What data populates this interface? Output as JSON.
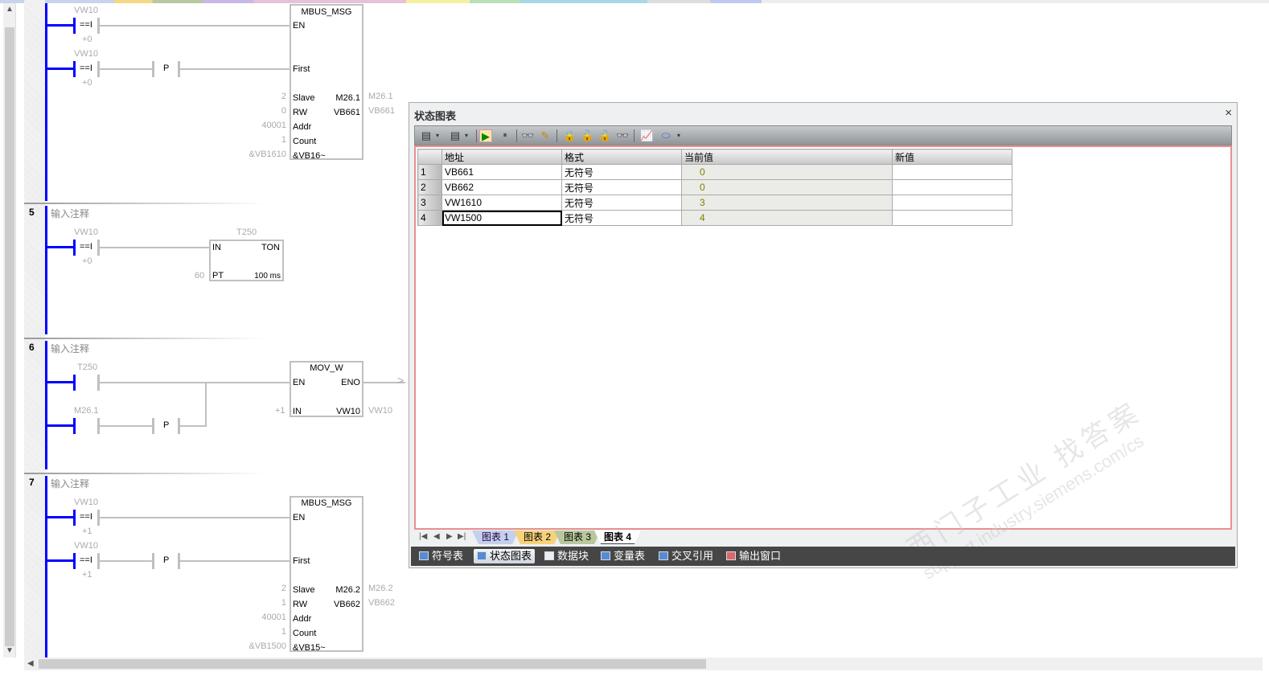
{
  "networks": [
    {
      "number": "",
      "rungs": [
        {
          "top": "VW10",
          "op": "==I",
          "bottom": "+0"
        },
        {
          "top": "VW10",
          "op": "==I",
          "bottom": "+0",
          "edge": "P"
        }
      ],
      "box": {
        "title": "MBUS_MSG",
        "inputs": [
          "EN",
          "First",
          "Slave",
          "RW",
          "Addr",
          "Count",
          "&VB16~"
        ],
        "input_values": [
          "2",
          "0",
          "40001",
          "1",
          "&VB1610"
        ],
        "outputs": [
          "M26.1",
          "VB661"
        ],
        "output_vars": [
          "M26.1",
          "VB661"
        ]
      }
    },
    {
      "number": "5",
      "comment": "输入注释",
      "rungs": [
        {
          "top": "VW10",
          "op": "==I",
          "bottom": "+0"
        }
      ],
      "box": {
        "name": "T250",
        "title": "TON",
        "inputs": [
          "IN",
          "PT"
        ],
        "pt_value": "60",
        "unit": "100 ms"
      }
    },
    {
      "number": "6",
      "comment": "输入注释",
      "rungs": [
        {
          "top": "T250"
        },
        {
          "top": "M26.1",
          "edge": "P"
        }
      ],
      "box": {
        "title": "MOV_W",
        "inputs": [
          "EN",
          "IN"
        ],
        "outputs": [
          "ENO",
          "VW10"
        ],
        "in_value": "+1",
        "output_var": "VW10"
      }
    },
    {
      "number": "7",
      "comment": "输入注释",
      "rungs": [
        {
          "top": "VW10",
          "op": "==I",
          "bottom": "+1"
        },
        {
          "top": "VW10",
          "op": "==I",
          "bottom": "+1",
          "edge": "P"
        }
      ],
      "box": {
        "title": "MBUS_MSG",
        "inputs": [
          "EN",
          "First",
          "Slave",
          "RW",
          "Addr",
          "Count",
          "&VB15~"
        ],
        "input_values": [
          "2",
          "1",
          "40001",
          "1",
          "&VB1500"
        ],
        "outputs": [
          "M26.2",
          "VB662"
        ],
        "output_vars": [
          "M26.2",
          "VB662"
        ]
      }
    }
  ],
  "status_chart": {
    "title": "状态图表",
    "close": "×",
    "toolbar_icons": [
      "add-row-icon",
      "delete-row-icon",
      "chart-status-icon",
      "pause-icon",
      "read-icon",
      "write-icon",
      "force-icon",
      "unforce-icon",
      "unforce-all-icon",
      "read-all-forced-icon",
      "trend-view-icon",
      "tag-icon"
    ],
    "columns": [
      "",
      "地址",
      "格式",
      "当前值",
      "新值"
    ],
    "rows": [
      {
        "n": "1",
        "address": "VB661",
        "format": "无符号",
        "current": "0",
        "new": ""
      },
      {
        "n": "2",
        "address": "VB662",
        "format": "无符号",
        "current": "0",
        "new": ""
      },
      {
        "n": "3",
        "address": "VW1610",
        "format": "无符号",
        "current": "3",
        "new": ""
      },
      {
        "n": "4",
        "address": "VW1500",
        "format": "无符号",
        "current": "4",
        "new": ""
      }
    ],
    "tabs": [
      "图表 1",
      "图表 2",
      "图表 3",
      "图表 4"
    ],
    "active_tab": "图表 4",
    "tab_colors": [
      "#c4d0ec",
      "#f6d27a",
      "#b8c89c",
      "#ffffff"
    ]
  },
  "bottom_bar": [
    "符号表",
    "状态图表",
    "数据块",
    "变量表",
    "交叉引用",
    "输出窗口"
  ],
  "bottom_bar_active": "状态图表",
  "watermark": {
    "line1": "西门子工业  找答案",
    "line2": "support.industry.siemens.com/cs"
  },
  "colors": {
    "power_rail": "#0000ff",
    "current_value": "#808000",
    "chart_border": "#e89090"
  }
}
